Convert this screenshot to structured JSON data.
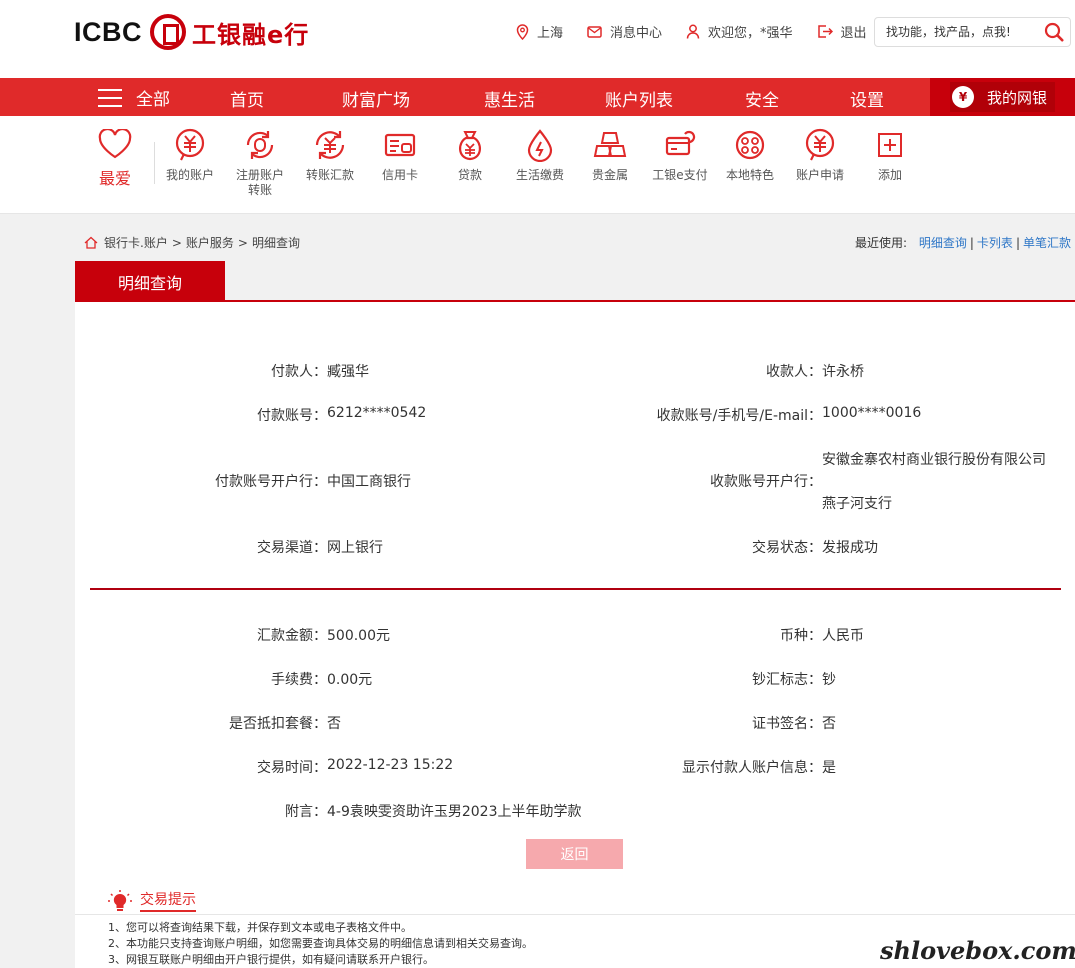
{
  "brand": {
    "en": "ICBC",
    "cn": "工银融e行"
  },
  "top_links": {
    "location": "上海",
    "messages": "消息中心",
    "welcome": "欢迎您，*强华",
    "logout": "退出"
  },
  "search": {
    "placeholder": "找功能，找产品，点我!"
  },
  "nav": {
    "all": "全部",
    "items": [
      "首页",
      "财富广场",
      "惠生活",
      "账户列表",
      "安全",
      "设置"
    ],
    "mybank": "我的网银"
  },
  "quick": {
    "fav": "最爱",
    "items": [
      {
        "label": "我的账户",
        "icon": "yuan-bubble-icon"
      },
      {
        "label": "注册账户\n转账",
        "icon": "register-transfer-icon"
      },
      {
        "label": "转账汇款",
        "icon": "transfer-icon"
      },
      {
        "label": "信用卡",
        "icon": "credit-card-icon"
      },
      {
        "label": "贷款",
        "icon": "loan-bag-icon"
      },
      {
        "label": "生活缴费",
        "icon": "utility-drop-icon"
      },
      {
        "label": "贵金属",
        "icon": "gold-bars-icon"
      },
      {
        "label": "工银e支付",
        "icon": "epay-icon"
      },
      {
        "label": "本地特色",
        "icon": "local-feature-icon"
      },
      {
        "label": "账户申请",
        "icon": "account-apply-icon"
      },
      {
        "label": "添加",
        "icon": "add-icon"
      }
    ]
  },
  "breadcrumb": {
    "l1": "银行卡.账户",
    "l2": "账户服务",
    "l3": "明细查询",
    "sep": ">"
  },
  "recent": {
    "label": "最近使用:",
    "links": [
      "明细查询",
      "卡列表",
      "单笔汇款"
    ]
  },
  "tab": {
    "active": "明细查询"
  },
  "details": {
    "payer_label": "付款人：",
    "payer": "臧强华",
    "payee_label": "收款人：",
    "payee": "许永桥",
    "payer_acct_label": "付款账号：",
    "payer_acct": "6212****0542",
    "payee_acct_label": "收款账号/手机号/E-mail：",
    "payee_acct": "1000****0016",
    "payer_bank_label": "付款账号开户行：",
    "payer_bank": "中国工商银行",
    "payee_bank_label": "收款账号开户行：",
    "payee_bank_1": "安徽金寨农村商业银行股份有限公司",
    "payee_bank_2": "燕子河支行",
    "channel_label": "交易渠道：",
    "channel": "网上银行",
    "status_label": "交易状态：",
    "status": "发报成功",
    "amount_label": "汇款金额：",
    "amount": "500.00元",
    "currency_label": "币种：",
    "currency": "人民币",
    "fee_label": "手续费：",
    "fee": "0.00元",
    "cash_flag_label": "钞汇标志：",
    "cash_flag": "钞",
    "package_label": "是否抵扣套餐：",
    "package": "否",
    "cert_label": "证书签名：",
    "cert": "否",
    "time_label": "交易时间：",
    "time": "2022-12-23 15:22",
    "show_payer_label": "显示付款人账户信息：",
    "show_payer": "是",
    "note_label": "附言：",
    "note": "4-9袁映雯资助许玉男2023上半年助学款"
  },
  "back_button": "返回",
  "tips": {
    "title": "交易提示",
    "lines": [
      "1、您可以将查询结果下载，并保存到文本或电子表格文件中。",
      "2、本功能只支持查询账户明细，如您需要查询具体交易的明细信息请到相关交易查询。",
      "3、网银互联账户明细由开户银行提供，如有疑问请联系开户银行。"
    ]
  },
  "watermark": "shlovebox.com",
  "colors": {
    "brand_red": "#c7000b",
    "nav_red": "#e02a2a",
    "link_blue": "#2f77c7"
  }
}
